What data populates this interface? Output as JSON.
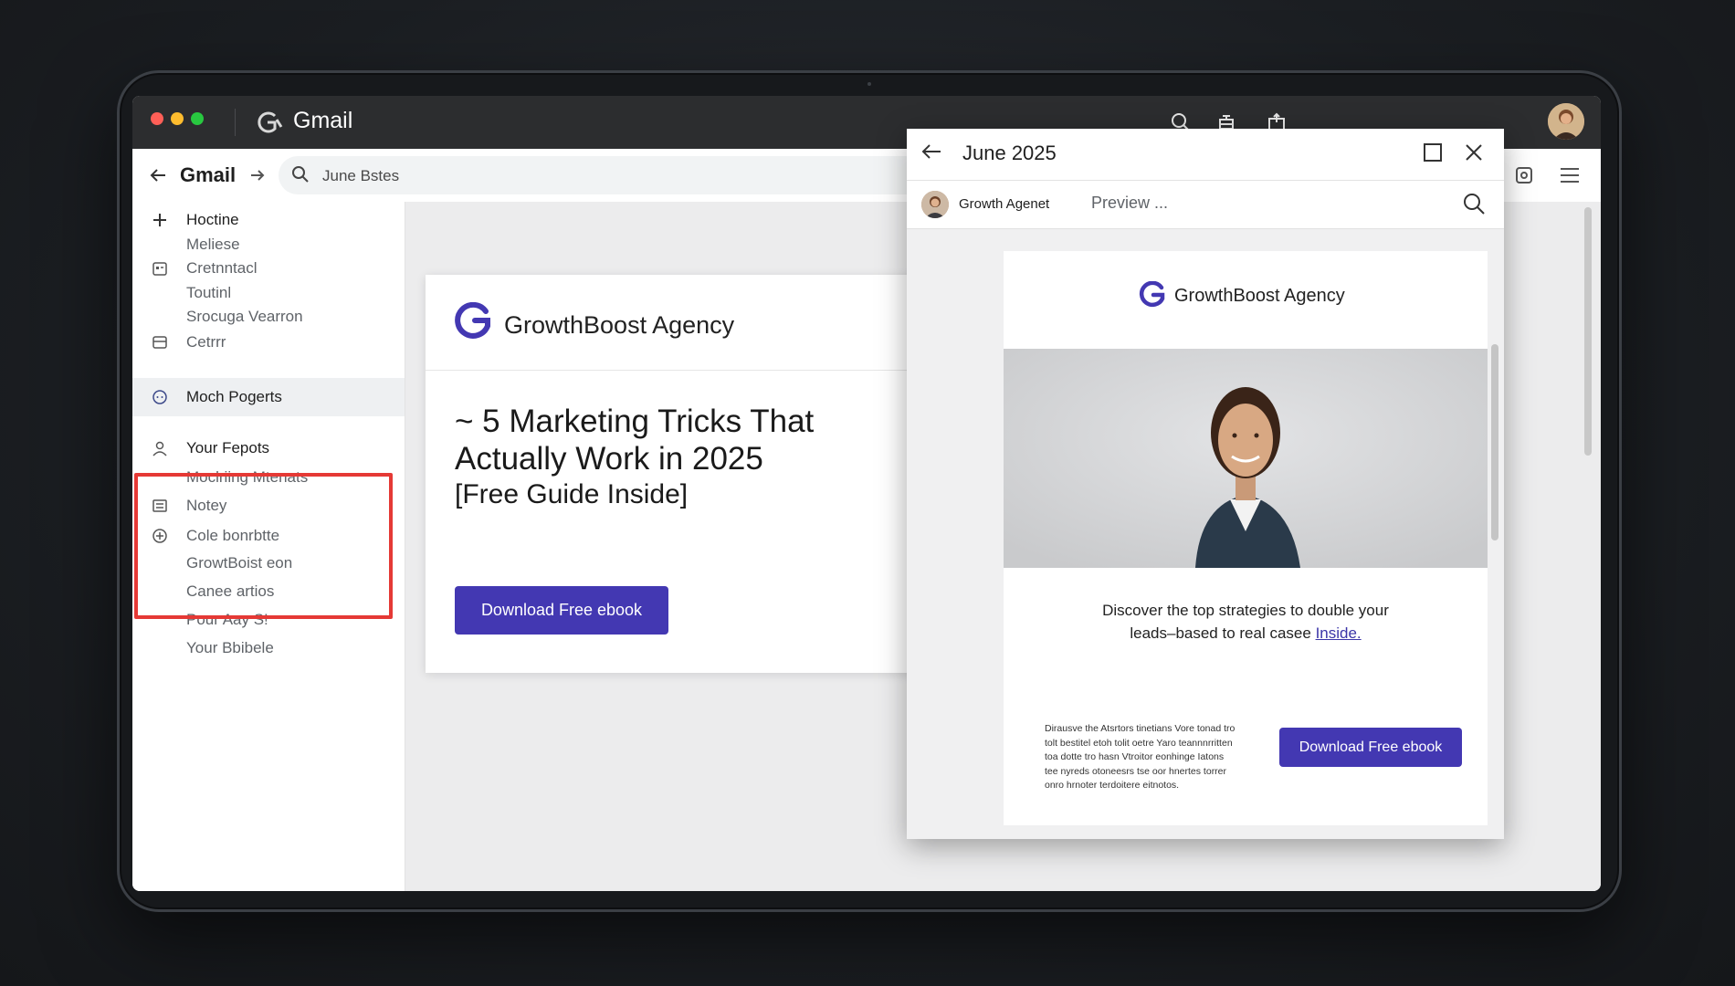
{
  "window": {
    "app_title": "Gmail"
  },
  "toolbar": {
    "gmail_label": "Gmail",
    "search_value": "June Bstes"
  },
  "sidebar": {
    "items": [
      {
        "label": "Hoctine"
      },
      {
        "label": "Meliese"
      },
      {
        "label": "Cretnntacl"
      },
      {
        "label": "Toutinl"
      },
      {
        "label": "Srocuga Vearron"
      },
      {
        "label": "Cetrrr"
      },
      {
        "label": "Moch Pogerts"
      },
      {
        "label": "Your Fepots"
      },
      {
        "label": "Moclriing Mtenats"
      },
      {
        "label": "Notey"
      },
      {
        "label": "Cole bonrbtte"
      },
      {
        "label": "GrowtBoist eon"
      },
      {
        "label": "Canee artios"
      },
      {
        "label": "Pour Aay S!"
      },
      {
        "label": "Your Bbibele"
      }
    ]
  },
  "main_card": {
    "brand": "GrowthBoost Agency",
    "title": "~ 5 Marketing Tricks That Actually Work in 2025",
    "subtitle": "[Free Guide Inside]",
    "button": "Download Free ebook"
  },
  "popup": {
    "title": "June 2025",
    "sender": "Growth Agenet",
    "preview": "Preview ...",
    "email": {
      "brand": "GrowthBoost Agency",
      "body": "Discover the top strategies to double your leads–based to real casee",
      "link": "Inside.",
      "fine_print": "Dirausve the Atsrtors tinetians Vore tonad tro tolt bestitel etoh tolit oetre Yaro teannnrritten toa dotte tro hasn Vtroitor eonhinge Iatons tee nyreds otoneesrs tse oor hnertes torrer onro hrnoter terdoitere eitnotos.",
      "button": "Download Free ebook"
    }
  },
  "colors": {
    "accent": "#4338b2",
    "highlight": "#e53935",
    "titlebar": "#2c2d2f"
  }
}
